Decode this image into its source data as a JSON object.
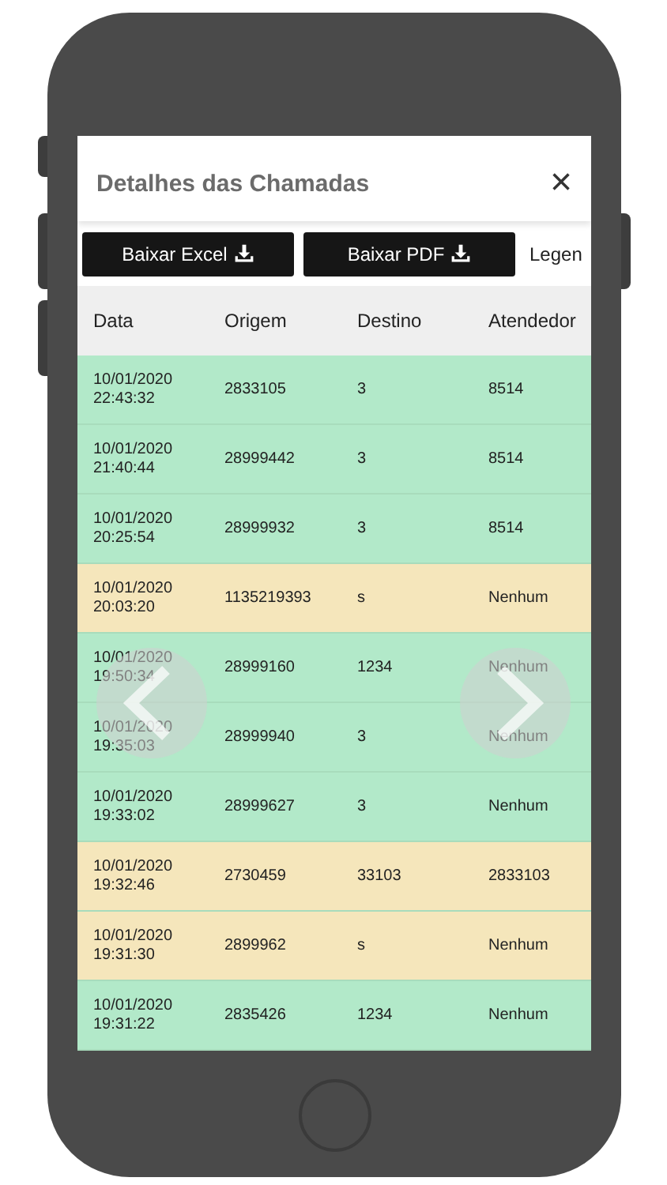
{
  "dialog": {
    "title": "Detalhes das Chamadas",
    "close": "×"
  },
  "buttons": [
    {
      "label": "Baixar Excel"
    },
    {
      "label": "Baixar PDF"
    }
  ],
  "legend_link": "Legen",
  "table": {
    "columns": [
      "Data",
      "Origem",
      "Destino",
      "Atendedor"
    ],
    "rows": [
      {
        "date": "10/01/2020",
        "time": "22:43:32",
        "origem": "2833105",
        "destino": "3",
        "atendedor": "8514",
        "color": "#b2e9c9"
      },
      {
        "date": "10/01/2020",
        "time": "21:40:44",
        "origem": "28999442",
        "destino": "3",
        "atendedor": "8514",
        "color": "#b2e9c9"
      },
      {
        "date": "10/01/2020",
        "time": "20:25:54",
        "origem": "28999932",
        "destino": "3",
        "atendedor": "8514",
        "color": "#b2e9c9"
      },
      {
        "date": "10/01/2020",
        "time": "20:03:20",
        "origem": "1135219393",
        "destino": "s",
        "atendedor": "Nenhum",
        "color": "#f5e6bb"
      },
      {
        "date": "10/01/2020",
        "time": "19:50:34",
        "origem": "28999160",
        "destino": "1234",
        "atendedor": "Nenhum",
        "color": "#b2e9c9"
      },
      {
        "date": "10/01/2020",
        "time": "19:35:03",
        "origem": "28999940",
        "destino": "3",
        "atendedor": "Nenhum",
        "color": "#b2e9c9"
      },
      {
        "date": "10/01/2020",
        "time": "19:33:02",
        "origem": "28999627",
        "destino": "3",
        "atendedor": "Nenhum",
        "color": "#b2e9c9"
      },
      {
        "date": "10/01/2020",
        "time": "19:32:46",
        "origem": "2730459",
        "destino": "33103",
        "atendedor": "2833103",
        "color": "#f5e6bb"
      },
      {
        "date": "10/01/2020",
        "time": "19:31:30",
        "origem": "2899962",
        "destino": "s",
        "atendedor": "Nenhum",
        "color": "#f5e6bb"
      },
      {
        "date": "10/01/2020",
        "time": "19:31:22",
        "origem": "2835426",
        "destino": "1234",
        "atendedor": "Nenhum",
        "color": "#b2e9c9"
      }
    ]
  }
}
